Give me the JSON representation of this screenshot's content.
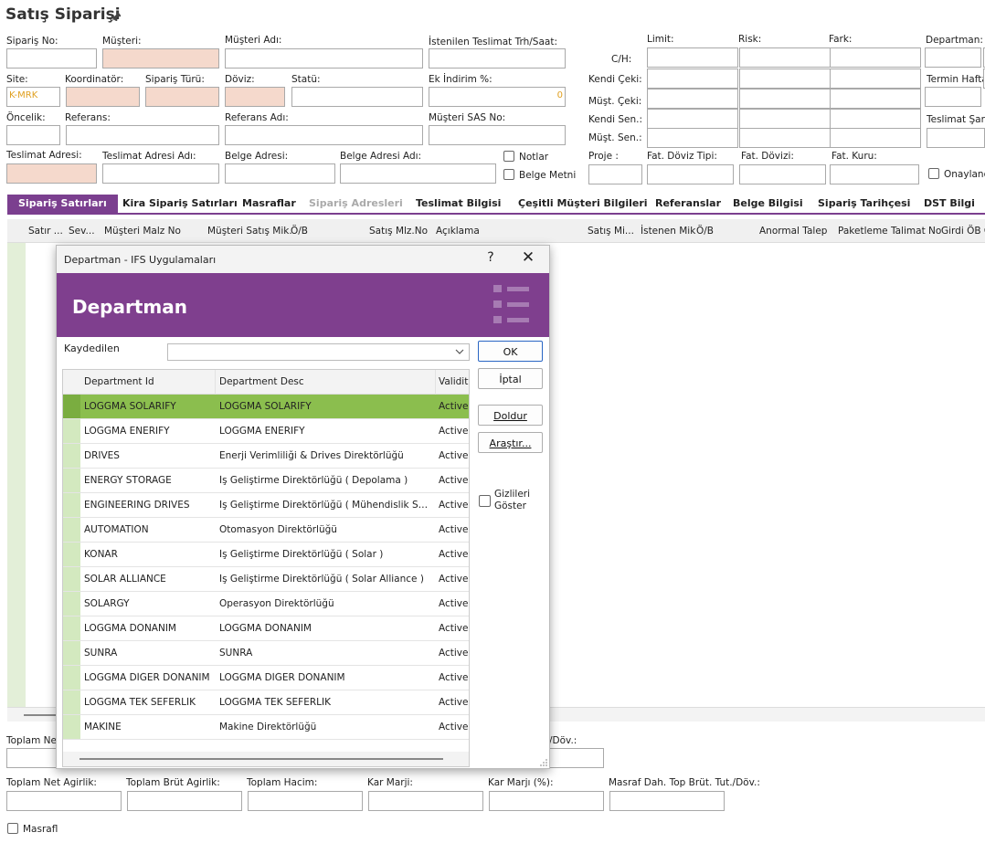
{
  "header": {
    "title": "Satış Siparişi",
    "pin": "🖈"
  },
  "form": {
    "order_no": "Sipariş No:",
    "customer": "Müşteri:",
    "customer_name": "Müşteri Adı:",
    "requested_delivery": "İstenilen Teslimat Trh/Saat:",
    "ch": "C/H:",
    "limit": "Limit:",
    "risk": "Risk:",
    "diff": "Fark:",
    "department": "Departman:",
    "site": "Site:",
    "site_value": "K-MRK",
    "coordinator": "Koordinatör:",
    "order_type": "Sipariş Türü:",
    "currency": "Döviz:",
    "status": "Statü:",
    "extra_discount": "Ek İndirim %:",
    "extra_discount_value": "0",
    "own_check": "Kendi Çeki:",
    "term_week": "Termin Haftası",
    "priority": "Öncelik:",
    "reference": "Referans:",
    "reference_name": "Referans Adı:",
    "customer_sas": "Müşteri SAS No:",
    "cust_check": "Müşt. Çeki:",
    "own_bond": "Kendi Sen.:",
    "delivery_terms": "Teslimat Şartı",
    "cust_bond": "Müşt. Sen.:",
    "delivery_address": "Teslimat Adresi:",
    "delivery_address_name": "Teslimat Adresi Adı:",
    "doc_address": "Belge Adresi:",
    "doc_address_name": "Belge Adresi Adı:",
    "notes": "Notlar",
    "doc_text": "Belge Metni",
    "project": "Proje :",
    "inv_fx_type": "Fat. Döviz Tipi:",
    "inv_currency": "Fat. Dövizi:",
    "inv_rate": "Fat. Kuru:",
    "approved": "Onaylandı"
  },
  "tabs": [
    "Sipariş Satırları",
    "Kira Sipariş Satırları",
    "Masraflar",
    "Sipariş Adresleri",
    "Teslimat Bilgisi",
    "Çeşitli Müşteri Bilgileri",
    "Referanslar",
    "Belge Bilgisi",
    "Sipariş Tarihçesi",
    "DST Bilgi"
  ],
  "grid_columns": [
    "Satır ...",
    "Sev...",
    "Müşteri Malz No",
    "Müşteri Satış Mik.",
    "Ö/B",
    "Satış Mlz.No",
    "Açıklama",
    "Satış Mi...",
    "İstenen Mik",
    "Ö/B",
    "Anormal Talep",
    "Paketleme Talimat No",
    "Girdi ÖB G"
  ],
  "footer": {
    "total_net": "Toplam Net",
    "dov_label": "/Döv.:",
    "net_weight": "Toplam Net Agirlik:",
    "gross_weight": "Toplam Brüt Agirlik:",
    "volume": "Toplam Hacim:",
    "margin": "Kar Marji:",
    "margin_pct": "Kar Marjı (%):",
    "cost_incl": "Masraf Dah. Top Brüt. Tut./Döv.:",
    "cost_check": "Masrafl"
  },
  "dialog": {
    "window_title": "Departman  - IFS Uygulamaları",
    "help": "?",
    "close": "✕",
    "heading": "Departman",
    "saved_label": "Kaydedilen",
    "saved_value": "",
    "ok": "OK",
    "cancel": "İptal",
    "fill": "Doldur",
    "search": "Araştır...",
    "show_hidden_1": "Gizlileri",
    "show_hidden_2": "Göster",
    "columns": [
      "Department Id",
      "Department Desc",
      "Validity"
    ],
    "rows": [
      {
        "id": "LOGGMA SOLARIFY",
        "desc": "LOGGMA SOLARIFY",
        "validity": "Active"
      },
      {
        "id": "LOGGMA ENERIFY",
        "desc": "LOGGMA ENERIFY",
        "validity": "Active"
      },
      {
        "id": "DRIVES",
        "desc": "Enerji Verimliliği & Drives Direktörlüğü",
        "validity": "Active"
      },
      {
        "id": "ENERGY STORAGE",
        "desc": "İş Geliştirme Direktörlüğü ( Depolama )",
        "validity": "Active"
      },
      {
        "id": "ENGINEERING DRIVES",
        "desc": "İş Geliştirme Direktörlüğü ( Mühendislik Sürücül...",
        "validity": "Active"
      },
      {
        "id": "AUTOMATION",
        "desc": "Otomasyon Direktörlüğü",
        "validity": "Active"
      },
      {
        "id": "KONAR",
        "desc": "İş Geliştirme Direktörlüğü ( Solar )",
        "validity": "Active"
      },
      {
        "id": "SOLAR ALLIANCE",
        "desc": "İş Geliştirme Direktörlüğü ( Solar Alliance )",
        "validity": "Active"
      },
      {
        "id": "SOLARGY",
        "desc": "Operasyon Direktörlüğü",
        "validity": "Active"
      },
      {
        "id": "LOGGMA DONANIM",
        "desc": "LOGGMA DONANIM",
        "validity": "Active"
      },
      {
        "id": "SUNRA",
        "desc": "SUNRA",
        "validity": "Active"
      },
      {
        "id": "LOGGMA DİĞER DONANIM",
        "desc": "LOGGMA DİĞER DONANIM",
        "validity": "Active"
      },
      {
        "id": "LOGGMA TEK SEFERLİK",
        "desc": "LOGGMA TEK SEFERLİK",
        "validity": "Active"
      },
      {
        "id": "MAKINE",
        "desc": "Makine Direktörlüğü",
        "validity": "Active"
      }
    ]
  },
  "colors": {
    "accent": "#7f3f8e",
    "selected_row": "#8bbe4e",
    "required_field": "#f5d9cc",
    "gutter": "#d3e9bf"
  }
}
